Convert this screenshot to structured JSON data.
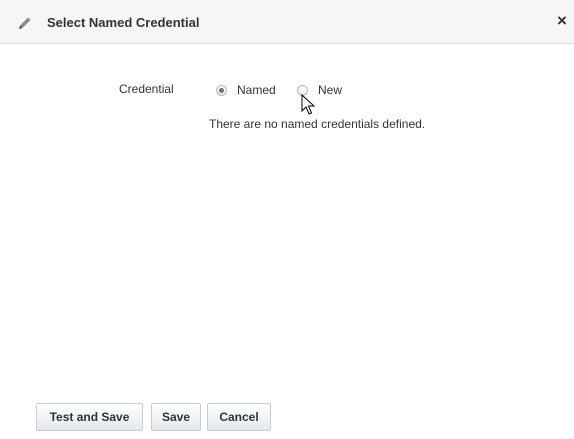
{
  "dialog": {
    "title": "Select Named Credential",
    "close_symbol": "×",
    "title_icon": "pencil-icon"
  },
  "form": {
    "credential_label": "Credential",
    "options": [
      {
        "label": "Named",
        "selected": true
      },
      {
        "label": "New",
        "selected": false
      }
    ],
    "info_message": "There are no named credentials defined."
  },
  "buttons": {
    "test_and_save": "Test and Save",
    "save": "Save",
    "cancel": "Cancel"
  }
}
